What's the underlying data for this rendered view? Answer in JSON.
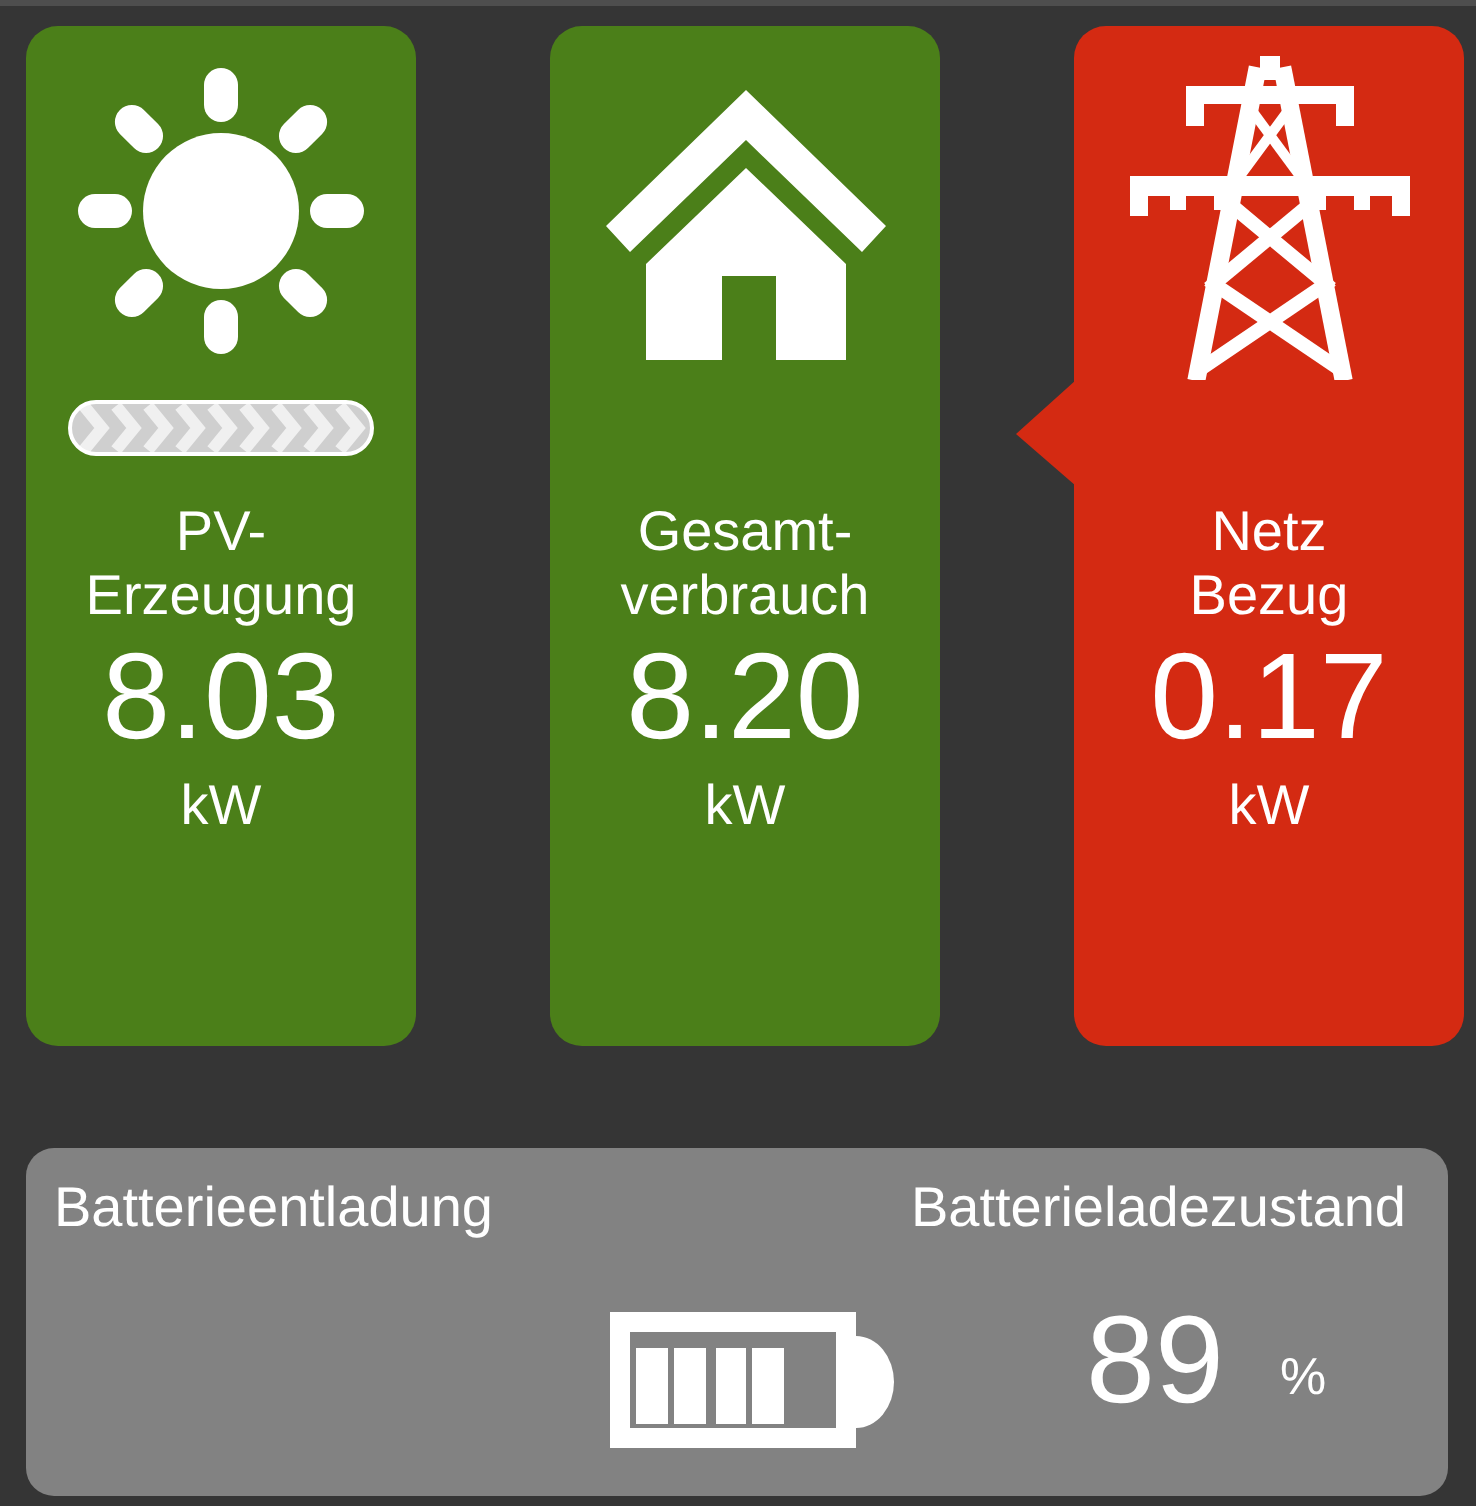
{
  "tiles": [
    {
      "kind": "solar",
      "color": "#4b7f19",
      "flow_indicator": true,
      "pointer": false,
      "label": "PV-\nErzeugung",
      "value": "8.03",
      "unit": "kW"
    },
    {
      "kind": "house",
      "color": "#4b7f19",
      "flow_indicator": false,
      "pointer": false,
      "label": "Gesamt-\nverbrauch",
      "value": "8.20",
      "unit": "kW"
    },
    {
      "kind": "grid",
      "color": "#d42a12",
      "flow_indicator": false,
      "pointer": true,
      "label": "Netz\nBezug",
      "value": "0.17",
      "unit": "kW"
    }
  ],
  "battery": {
    "discharge_label": "Batterieentladung",
    "soc_label": "Batterieladezustand",
    "soc_value": "89",
    "soc_unit": "%"
  }
}
